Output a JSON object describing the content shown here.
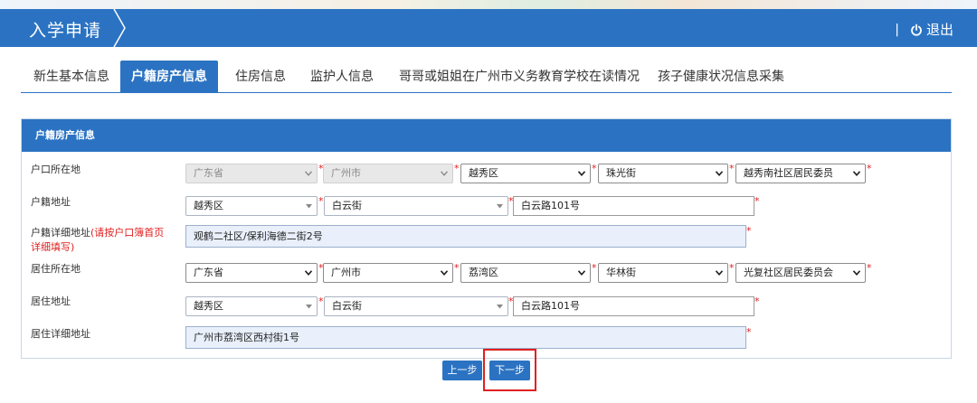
{
  "header": {
    "title": "入学申请",
    "separator": "|",
    "logout_label": "退出"
  },
  "tabs": [
    {
      "label": "新生基本信息",
      "active": false
    },
    {
      "label": "户籍房产信息",
      "active": true
    },
    {
      "label": "住房信息",
      "active": false
    },
    {
      "label": "监护人信息",
      "active": false
    },
    {
      "label": "哥哥或姐姐在广州市义务教育学校在读情况",
      "active": false
    },
    {
      "label": "孩子健康状况信息采集",
      "active": false
    }
  ],
  "panel": {
    "title": "户籍房产信息",
    "required_mark": "*",
    "hukou_location": {
      "label": "户口所在地",
      "province": "广东省",
      "city": "广州市",
      "district": "越秀区",
      "street": "珠光街",
      "community": "越秀南社区居民委员"
    },
    "hukou_address": {
      "label": "户籍地址",
      "district": "越秀区",
      "street": "白云街",
      "road": "白云路101号"
    },
    "hukou_detail": {
      "label": "户籍详细地址",
      "hint": "(请按户口簿首页详细填写)",
      "value": "观鹤二社区/保利海德二街2号"
    },
    "residence_location": {
      "label": "居住所在地",
      "province": "广东省",
      "city": "广州市",
      "district": "荔湾区",
      "street": "华林街",
      "community": "光复社区居民委员会"
    },
    "residence_address": {
      "label": "居住地址",
      "district": "越秀区",
      "street": "白云街",
      "road": "白云路101号"
    },
    "residence_detail": {
      "label": "居住详细地址",
      "value": "广州市荔湾区西村街1号"
    }
  },
  "buttons": {
    "prev_label": "上一步",
    "next_label": "下一步"
  },
  "colors": {
    "primary": "#2b73c2",
    "required": "#e02020",
    "input_bg": "#e9f0fb"
  }
}
